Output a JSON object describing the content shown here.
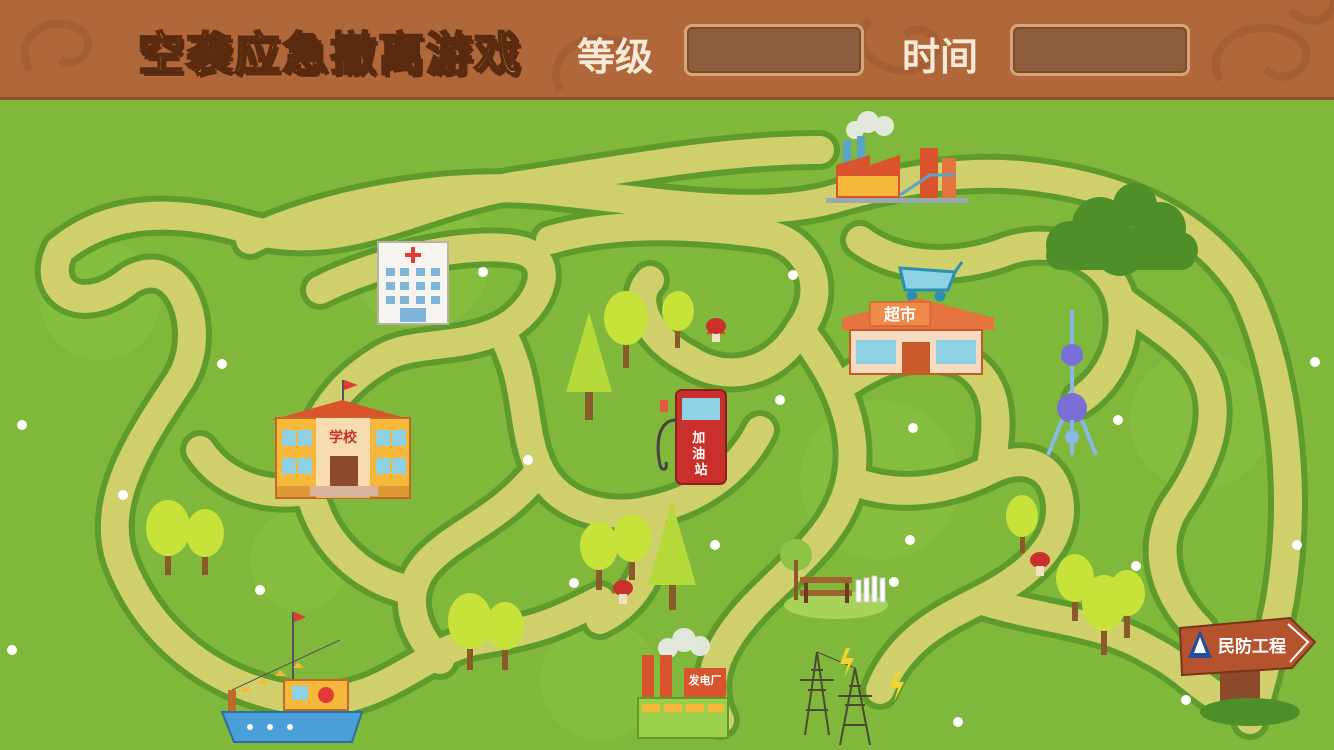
{
  "header": {
    "title": "空袭应急撤离游戏",
    "level_label": "等级",
    "level_value": "",
    "time_label": "时间",
    "time_value": ""
  },
  "map": {
    "buildings": {
      "school_label": "学校",
      "gas_station_label": "加油站",
      "supermarket_label": "超市",
      "power_plant_label": "发电厂"
    },
    "destination_sign": "民防工程"
  },
  "colors": {
    "header_bg": "#b0683a",
    "title_fill": "#ffe14a",
    "grass": "#7fb83a",
    "path": "#c9cf6a",
    "sign": "#b4532e"
  }
}
